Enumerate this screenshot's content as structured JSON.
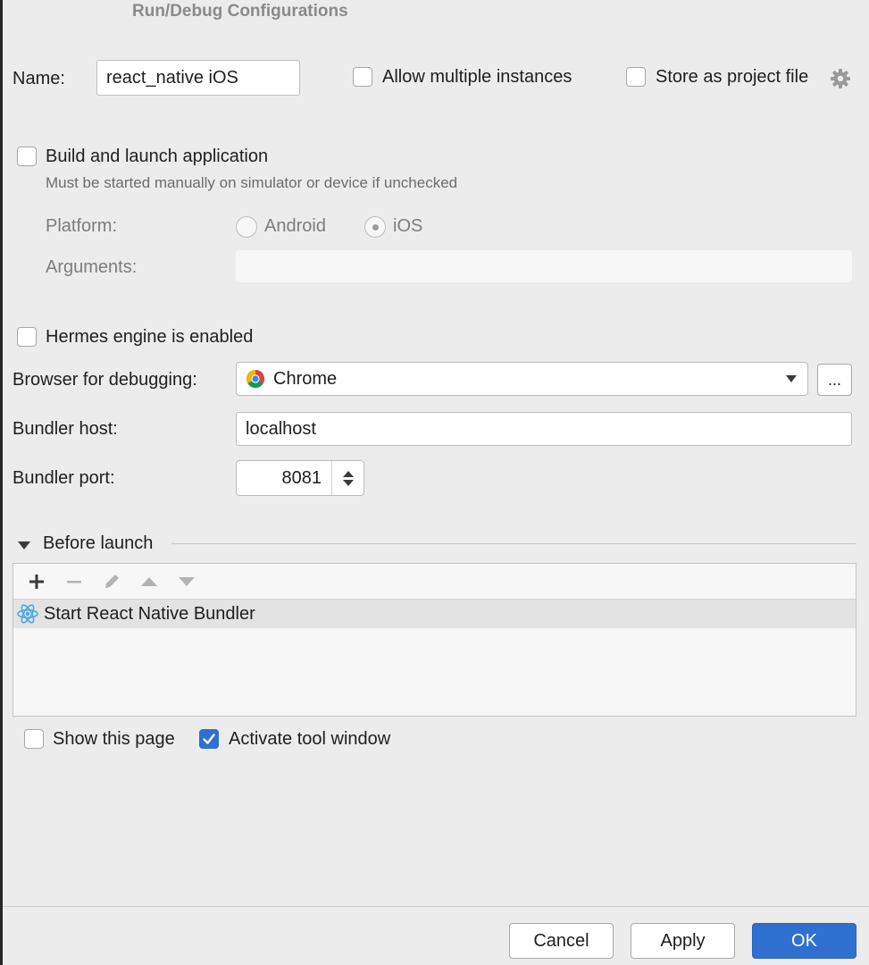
{
  "dialog": {
    "title": "Run/Debug Configurations"
  },
  "name_row": {
    "label": "Name:",
    "value": "react_native iOS",
    "allow_multiple": {
      "label": "Allow multiple instances",
      "checked": false
    },
    "store_project": {
      "label": "Store as project file",
      "checked": false
    }
  },
  "build": {
    "label": "Build and launch application",
    "checked": false,
    "hint": "Must be started manually on simulator or device if unchecked",
    "platform_label": "Platform:",
    "platform_options": [
      "Android",
      "iOS"
    ],
    "platform_selected": "iOS",
    "arguments_label": "Arguments:",
    "arguments_value": ""
  },
  "hermes": {
    "label": "Hermes engine is enabled",
    "checked": false
  },
  "browser": {
    "label": "Browser for debugging:",
    "value": "Chrome",
    "browse_label": "..."
  },
  "bundler_host": {
    "label": "Bundler host:",
    "value": "localhost"
  },
  "bundler_port": {
    "label": "Bundler port:",
    "value": "8081"
  },
  "before_launch": {
    "label": "Before launch",
    "toolbar": [
      "add",
      "remove",
      "edit",
      "move-up",
      "move-down"
    ],
    "items": [
      {
        "label": "Start React Native Bundler",
        "icon": "react-icon"
      }
    ]
  },
  "options": {
    "show_page": {
      "label": "Show this page",
      "checked": false
    },
    "activate_tool": {
      "label": "Activate tool window",
      "checked": true
    }
  },
  "footer": {
    "cancel": "Cancel",
    "apply": "Apply",
    "ok": "OK"
  },
  "colors": {
    "accent": "#2f6fd0",
    "background": "#ececec",
    "selection": "#e3e3e3"
  }
}
